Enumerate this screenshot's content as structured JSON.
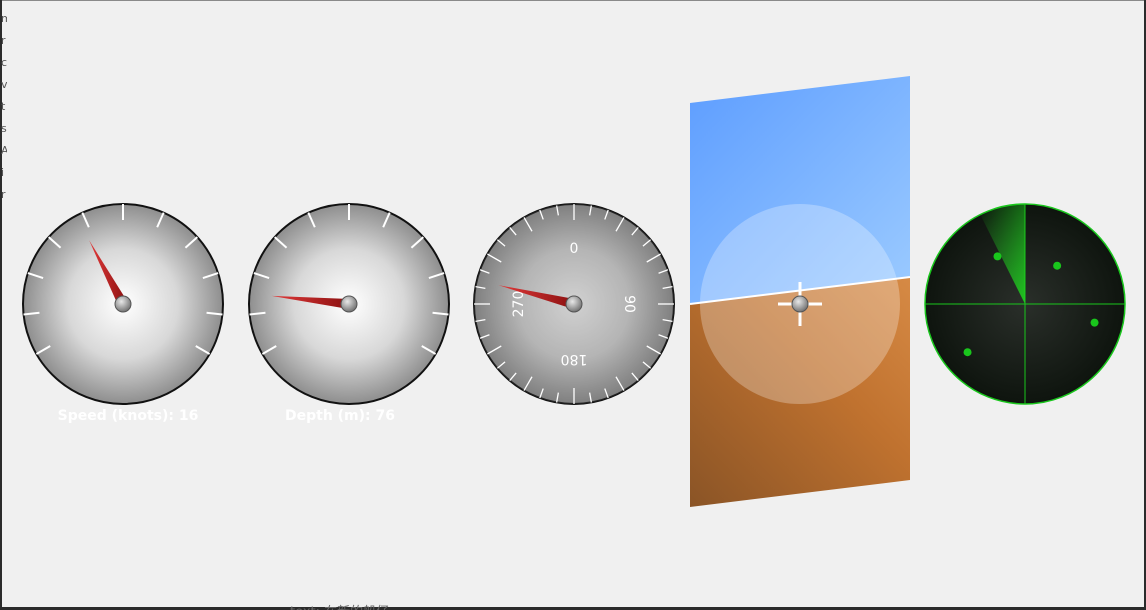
{
  "side_text": [
    "m",
    "r",
    "c",
    "v",
    "t",
    "s",
    "A",
    "i",
    "r"
  ],
  "speed_gauge": {
    "label": "Speed (knots): 16",
    "value": 16
  },
  "depth_gauge": {
    "label": "Depth (m): 76",
    "value": 76
  },
  "heading_gauge": {
    "labels": [
      "0",
      "90",
      "180",
      "270"
    ],
    "heading_deg": 284
  },
  "attitude_indicator": {
    "sky_color": "#6fa8ff",
    "ground_color": "#b8722f",
    "horizon_tilt_deg": -4
  },
  "radar": {
    "color": "#19c61c",
    "background": "#101810",
    "blips": [
      {
        "angle_deg": 330,
        "range": 0.55
      },
      {
        "angle_deg": 40,
        "range": 0.5
      },
      {
        "angle_deg": 105,
        "range": 0.72
      },
      {
        "angle_deg": 230,
        "range": 0.75
      }
    ]
  },
  "bottom_text": "text: 在新的船仔"
}
